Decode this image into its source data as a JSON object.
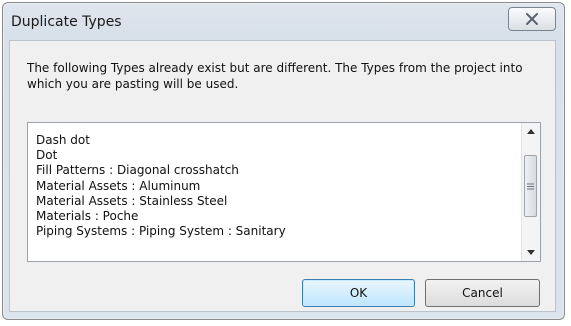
{
  "window": {
    "title": "Duplicate Types",
    "close_icon": "close-icon"
  },
  "message": "The following Types already exist but are different. The Types from the project into which you are pasting will be used.",
  "list": {
    "items": [
      "Dash dot",
      "Dot",
      "Fill Patterns : Diagonal crosshatch",
      "Material Assets : Aluminum",
      "Material Assets : Stainless Steel",
      "Materials : Poche",
      "Piping Systems : Piping System : Sanitary"
    ],
    "scrollbar": {
      "up_icon": "scroll-up-arrow-icon",
      "down_icon": "scroll-down-arrow-icon",
      "grip_icon": "scroll-grip-icon"
    }
  },
  "buttons": {
    "ok_label": "OK",
    "cancel_label": "Cancel"
  },
  "colors": {
    "ok_button_border": "#3c7fb1",
    "ok_button_fill": "#bee6fd",
    "dialog_frame": "#dbe3ec",
    "client_bg": "#f0f0f0"
  }
}
